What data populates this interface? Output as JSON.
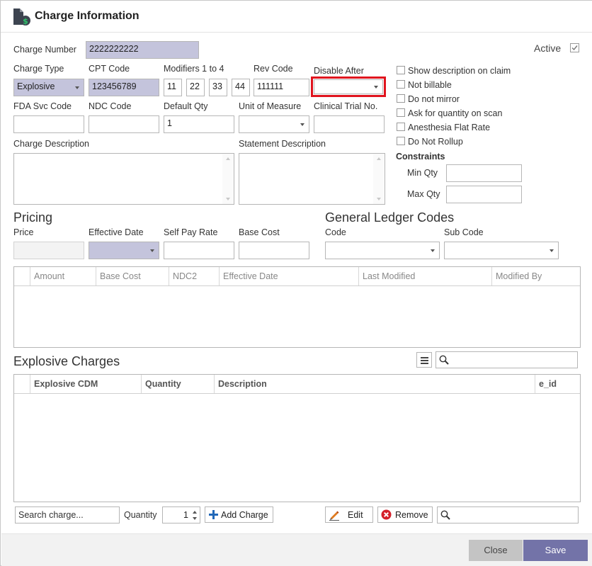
{
  "title": "Charge Information",
  "active": {
    "label": "Active",
    "checked": true
  },
  "fields": {
    "charge_number": {
      "label": "Charge Number",
      "value": "2222222222"
    },
    "charge_type": {
      "label": "Charge Type",
      "value": "Explosive"
    },
    "cpt_code": {
      "label": "CPT Code",
      "value": "123456789"
    },
    "modifiers": {
      "label": "Modifiers 1 to 4",
      "values": [
        "11",
        "22",
        "33",
        "44"
      ]
    },
    "rev_code": {
      "label": "Rev Code",
      "value": "111111"
    },
    "disable_after": {
      "label": "Disable After",
      "value": ""
    },
    "fda_svc_code": {
      "label": "FDA Svc Code",
      "value": ""
    },
    "ndc_code": {
      "label": "NDC Code",
      "value": ""
    },
    "default_qty": {
      "label": "Default Qty",
      "value": "1"
    },
    "unit_of_measure": {
      "label": "Unit of Measure",
      "value": ""
    },
    "clinical_trial_no": {
      "label": "Clinical Trial No.",
      "value": ""
    },
    "charge_description": {
      "label": "Charge Description",
      "value": ""
    },
    "statement_description": {
      "label": "Statement Description",
      "value": ""
    }
  },
  "options": [
    {
      "label": "Show description on claim",
      "checked": false
    },
    {
      "label": "Not billable",
      "checked": false
    },
    {
      "label": "Do not mirror",
      "checked": false
    },
    {
      "label": "Ask for quantity on scan",
      "checked": false
    },
    {
      "label": "Anesthesia Flat Rate",
      "checked": false
    },
    {
      "label": "Do Not Rollup",
      "checked": false
    }
  ],
  "constraints": {
    "heading": "Constraints",
    "min_label": "Min Qty",
    "min_value": "",
    "max_label": "Max Qty",
    "max_value": ""
  },
  "pricing": {
    "heading": "Pricing",
    "price_label": "Price",
    "price_value": "",
    "effective_date_label": "Effective Date",
    "effective_date_value": "",
    "self_pay_label": "Self Pay Rate",
    "self_pay_value": "",
    "base_cost_label": "Base Cost",
    "base_cost_value": ""
  },
  "gl": {
    "heading": "General Ledger Codes",
    "code_label": "Code",
    "code_value": "",
    "sub_code_label": "Sub Code",
    "sub_code_value": ""
  },
  "pricing_grid": {
    "columns": [
      "Amount",
      "Base Cost",
      "NDC2",
      "Effective Date",
      "Last Modified",
      "Modified By"
    ]
  },
  "explosive": {
    "heading": "Explosive Charges",
    "search_value": "",
    "columns": [
      "Explosive CDM",
      "Quantity",
      "Description",
      "e_id"
    ]
  },
  "bottom_bar": {
    "search_charge": "Search charge...",
    "quantity_label": "Quantity",
    "quantity_value": "1",
    "add_charge": "Add Charge",
    "edit": "Edit",
    "remove": "Remove",
    "search_value": ""
  },
  "footer": {
    "close": "Close",
    "save": "Save"
  },
  "colors": {
    "readonly_fill": "#c4c4dc",
    "highlight_border": "#e0141e",
    "save_button": "#7373a8",
    "close_button": "#c4c4c4"
  }
}
